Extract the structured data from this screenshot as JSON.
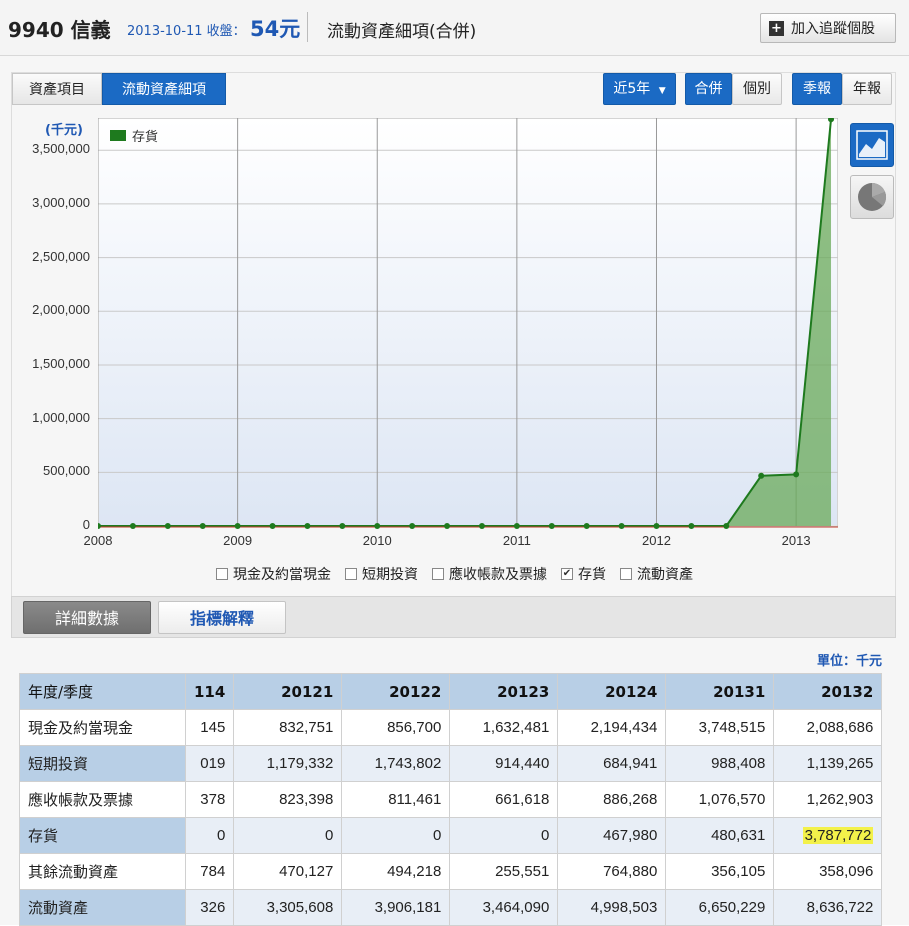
{
  "header": {
    "code_name": "9940 信義",
    "date_label": "2013-10-11 收盤：",
    "price": "54元",
    "page_title": "流動資產細項(合併)",
    "add_button": "加入追蹤個股",
    "plus_glyph": "+"
  },
  "tabs": {
    "asset_items": "資產項目",
    "current_asset_details": "流動資產細項"
  },
  "controls": {
    "period": "近5年",
    "consolidated": "合併",
    "individual": "個別",
    "quarterly": "季報",
    "annual": "年報"
  },
  "chart_data": {
    "type": "area",
    "unit_label": "(千元)",
    "legend": "存貨",
    "series_color": "#1e7a1e",
    "fill_color": "#6aaa5a",
    "y_ticks": [
      "3,500,000",
      "3,000,000",
      "2,500,000",
      "2,000,000",
      "1,500,000",
      "1,000,000",
      "500,000",
      "0"
    ],
    "x_ticks": [
      "2008",
      "2009",
      "2010",
      "2011",
      "2012",
      "2013"
    ],
    "ylim": [
      0,
      3800000
    ],
    "xlim": [
      2008,
      2013.3
    ],
    "x": [
      2008.0,
      2008.25,
      2008.5,
      2008.75,
      2009.0,
      2009.25,
      2009.5,
      2009.75,
      2010.0,
      2010.25,
      2010.5,
      2010.75,
      2011.0,
      2011.25,
      2011.5,
      2011.75,
      2012.0,
      2012.25,
      2012.5,
      2012.75,
      2013.0,
      2013.25
    ],
    "values": [
      0,
      0,
      0,
      0,
      0,
      0,
      0,
      0,
      0,
      0,
      0,
      0,
      0,
      0,
      0,
      0,
      0,
      0,
      0,
      467980,
      480631,
      3787772
    ],
    "grid": true,
    "legend_position": "top-left"
  },
  "legend_checkboxes": [
    {
      "label": "現金及約當現金",
      "checked": false
    },
    {
      "label": "短期投資",
      "checked": false
    },
    {
      "label": "應收帳款及票據",
      "checked": false
    },
    {
      "label": "存貨",
      "checked": true
    },
    {
      "label": "流動資產",
      "checked": false
    }
  ],
  "detail_tabs": {
    "details": "詳細數據",
    "explain": "指標解釋"
  },
  "unit_text": "單位：千元",
  "table": {
    "header_label": "年度/季度",
    "columns": [
      "114",
      "20121",
      "20122",
      "20123",
      "20124",
      "20131",
      "20132"
    ],
    "rows": [
      {
        "label": "現金及約當現金",
        "values": [
          "145",
          "832,751",
          "856,700",
          "1,632,481",
          "2,194,434",
          "3,748,515",
          "2,088,686"
        ]
      },
      {
        "label": "短期投資",
        "values": [
          "019",
          "1,179,332",
          "1,743,802",
          "914,440",
          "684,941",
          "988,408",
          "1,139,265"
        ]
      },
      {
        "label": "應收帳款及票據",
        "values": [
          "378",
          "823,398",
          "811,461",
          "661,618",
          "886,268",
          "1,076,570",
          "1,262,903"
        ]
      },
      {
        "label": "存貨",
        "values": [
          "0",
          "0",
          "0",
          "0",
          "467,980",
          "480,631",
          "3,787,772"
        ]
      },
      {
        "label": "其餘流動資產",
        "values": [
          "784",
          "470,127",
          "494,218",
          "255,551",
          "764,880",
          "356,105",
          "358,096"
        ]
      },
      {
        "label": "流動資產",
        "values": [
          "326",
          "3,305,608",
          "3,906,181",
          "3,464,090",
          "4,998,503",
          "6,650,229",
          "8,636,722"
        ]
      }
    ]
  }
}
